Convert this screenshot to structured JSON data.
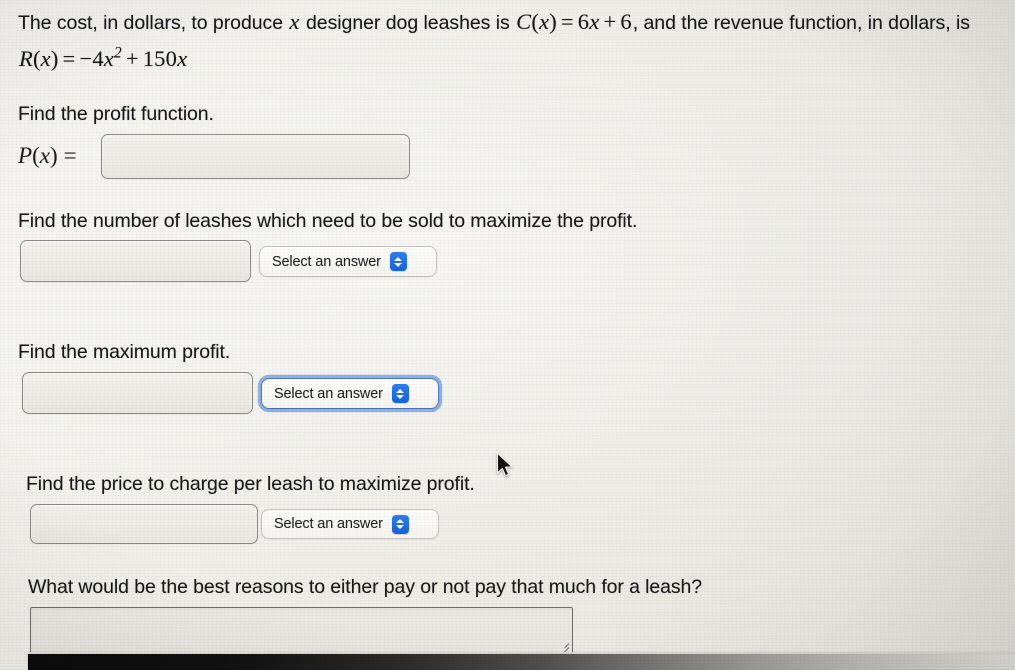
{
  "problem": {
    "statement_parts": [
      {
        "type": "text",
        "value": "The cost, in dollars, to produce "
      },
      {
        "type": "math",
        "value": "x"
      },
      {
        "type": "text",
        "value": " designer dog leashes is "
      },
      {
        "type": "math",
        "value": "C(x) = 6x + 6"
      },
      {
        "type": "text",
        "value": ", and the revenue function, in dollars, is "
      },
      {
        "type": "math",
        "value": "R(x) = −4x² + 150x"
      }
    ],
    "statement_text": "The cost, in dollars, to produce x designer dog leashes is C(x) = 6x + 6, and the revenue function, in dollars, is R(x) = -4x^2 + 150x",
    "cost_function": "C(x) = 6x + 6",
    "revenue_function": "R(x) = -4x^2 + 150x",
    "variable": "x"
  },
  "questions": [
    {
      "id": "profit-function",
      "prompt": "Find the profit function.",
      "equation_label": "P(x) =",
      "input_value": "",
      "input_placeholder": "",
      "has_select": false
    },
    {
      "id": "number-of-leashes",
      "prompt": "Find the number of leashes which need to be sold to maximize the profit.",
      "input_value": "",
      "input_placeholder": "",
      "has_select": true,
      "select_label": "Select an answer",
      "select_focused": false
    },
    {
      "id": "maximum-profit",
      "prompt": "Find the maximum profit.",
      "input_value": "",
      "input_placeholder": "",
      "has_select": true,
      "select_label": "Select an answer",
      "select_focused": true
    },
    {
      "id": "price-per-leash",
      "prompt": "Find the price to charge per leash to maximize profit.",
      "input_value": "",
      "input_placeholder": "",
      "has_select": true,
      "select_label": "Select an answer",
      "select_focused": false
    },
    {
      "id": "best-reasons",
      "prompt": "What would be the best reasons to either pay or not pay that much for a leash?",
      "input_value": "",
      "input_placeholder": "",
      "has_select": false,
      "is_textarea": true
    }
  ],
  "icons": {
    "stepper": "up-down-chevron-icon",
    "resize": "resize-grip-icon",
    "cursor": "mouse-pointer-icon"
  },
  "colors": {
    "page_background": "#f1f0ea",
    "text": "#16181a",
    "stepper_blue": "#1f6fe0",
    "focus_ring": "#5a87d2",
    "input_border": "#8c8d8a"
  }
}
